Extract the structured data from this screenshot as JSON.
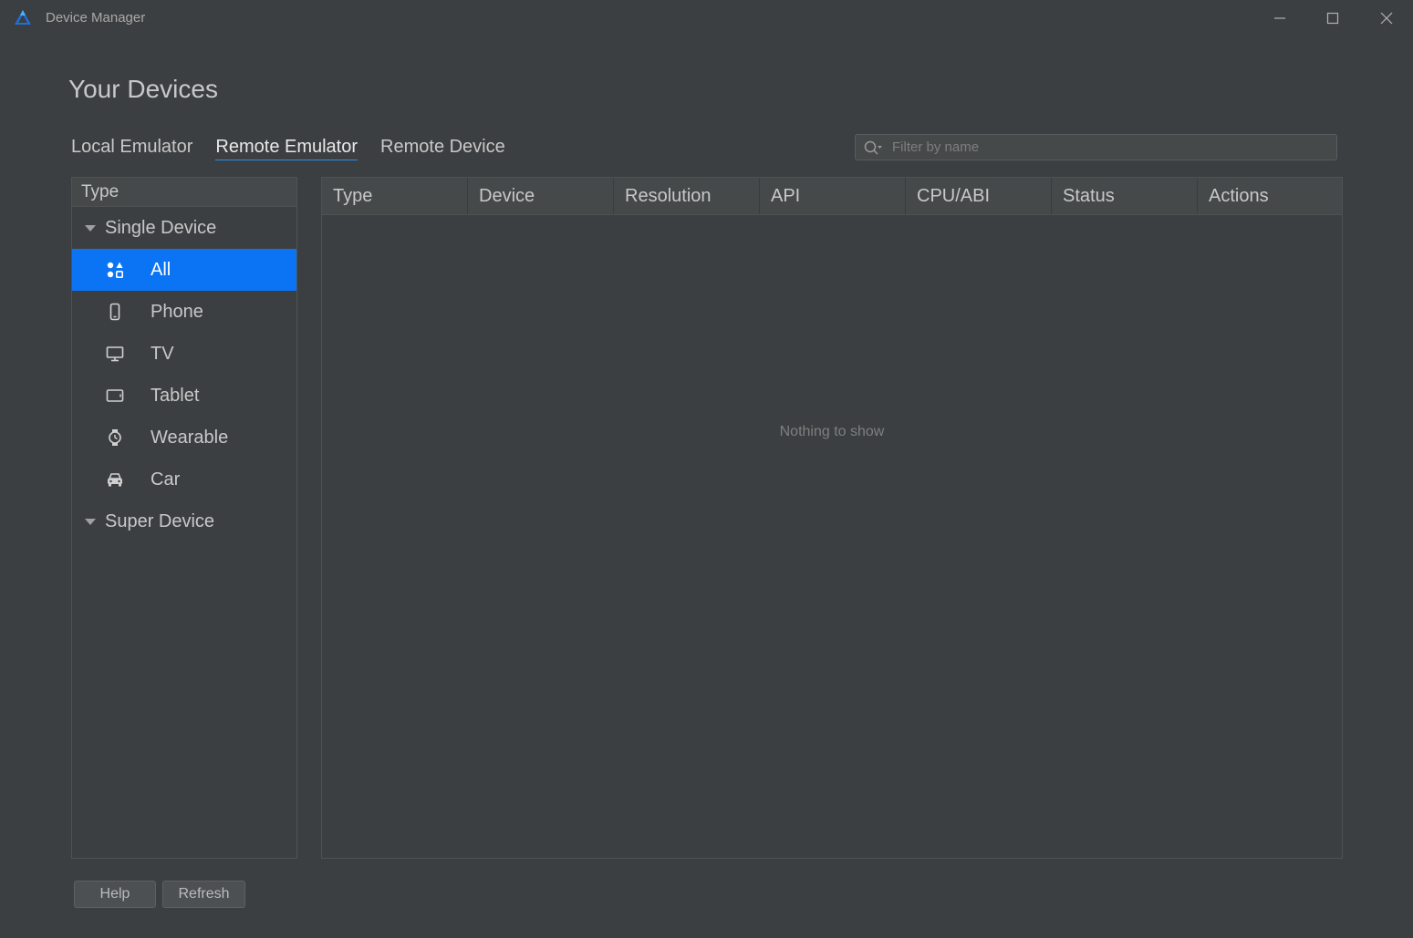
{
  "window": {
    "title": "Device Manager",
    "logo_icon": "harmony-logo-icon",
    "controls": [
      "minimize-icon",
      "maximize-icon",
      "close-icon"
    ]
  },
  "page": {
    "title": "Your Devices"
  },
  "tabs": [
    {
      "label": "Local Emulator",
      "active": false
    },
    {
      "label": "Remote Emulator",
      "active": true
    },
    {
      "label": "Remote Device",
      "active": false
    }
  ],
  "search": {
    "placeholder": "Filter by name",
    "value": "",
    "icon": "search-icon"
  },
  "sidebar": {
    "header": "Type",
    "groups": [
      {
        "label": "Single Device",
        "expanded": true,
        "items": [
          {
            "label": "All",
            "icon": "grid-shapes-icon",
            "selected": true
          },
          {
            "label": "Phone",
            "icon": "phone-icon",
            "selected": false
          },
          {
            "label": "TV",
            "icon": "tv-icon",
            "selected": false
          },
          {
            "label": "Tablet",
            "icon": "tablet-icon",
            "selected": false
          },
          {
            "label": "Wearable",
            "icon": "watch-icon",
            "selected": false
          },
          {
            "label": "Car",
            "icon": "car-icon",
            "selected": false
          }
        ]
      },
      {
        "label": "Super Device",
        "expanded": true,
        "items": []
      }
    ]
  },
  "table": {
    "columns": [
      "Type",
      "Device",
      "Resolution",
      "API",
      "CPU/ABI",
      "Status",
      "Actions"
    ],
    "rows": [],
    "empty_text": "Nothing to show"
  },
  "footer": {
    "help_label": "Help",
    "refresh_label": "Refresh"
  },
  "colors": {
    "background": "#3c3f41",
    "accent": "#0a74f5",
    "tab_underline": "#2f8cf0"
  }
}
